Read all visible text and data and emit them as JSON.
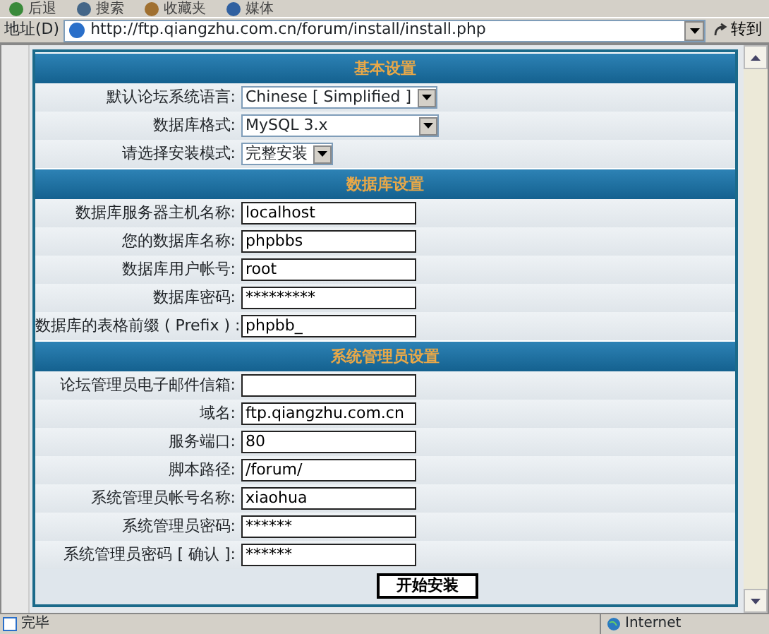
{
  "toolbar": {
    "buttons": [
      "后退",
      "搜索",
      "收藏夹",
      "媒体"
    ]
  },
  "address_bar": {
    "label": "地址(D)",
    "url": "http://ftp.qiangzhu.com.cn/forum/install/install.php",
    "go": "转到"
  },
  "sections": [
    {
      "title": "基本设置",
      "rows": [
        {
          "label": "默认论坛系统语言:",
          "kind": "select",
          "value": "Chinese [ Simplified ]"
        },
        {
          "label": "数据库格式:",
          "kind": "select",
          "value": "MySQL 3.x",
          "wide": true
        },
        {
          "label": "请选择安装模式:",
          "kind": "select",
          "value": "完整安装"
        }
      ]
    },
    {
      "title": "数据库设置",
      "rows": [
        {
          "label": "数据库服务器主机名称:",
          "kind": "input",
          "value": "localhost"
        },
        {
          "label": "您的数据库名称:",
          "kind": "input",
          "value": "phpbbs"
        },
        {
          "label": "数据库用户帐号:",
          "kind": "input",
          "value": "root"
        },
        {
          "label": "数据库密码:",
          "kind": "input",
          "value": "*********"
        },
        {
          "label": "数据库的表格前缀 ( Prefix ) :",
          "kind": "input",
          "value": "phpbb_"
        }
      ]
    },
    {
      "title": "系统管理员设置",
      "rows": [
        {
          "label": "论坛管理员电子邮件信箱:",
          "kind": "input",
          "value": ""
        },
        {
          "label": "域名:",
          "kind": "input",
          "value": "ftp.qiangzhu.com.cn"
        },
        {
          "label": "服务端口:",
          "kind": "input",
          "value": "80"
        },
        {
          "label": "脚本路径:",
          "kind": "input",
          "value": "/forum/"
        },
        {
          "label": "系统管理员帐号名称:",
          "kind": "input",
          "value": "xiaohua"
        },
        {
          "label": "系统管理员密码:",
          "kind": "input",
          "value": "******"
        },
        {
          "label": "系统管理员密码 [ 确认 ]:",
          "kind": "input",
          "value": "******"
        }
      ]
    }
  ],
  "submit": "开始安装",
  "status_bar": {
    "text": "完毕",
    "zone": "Internet"
  }
}
